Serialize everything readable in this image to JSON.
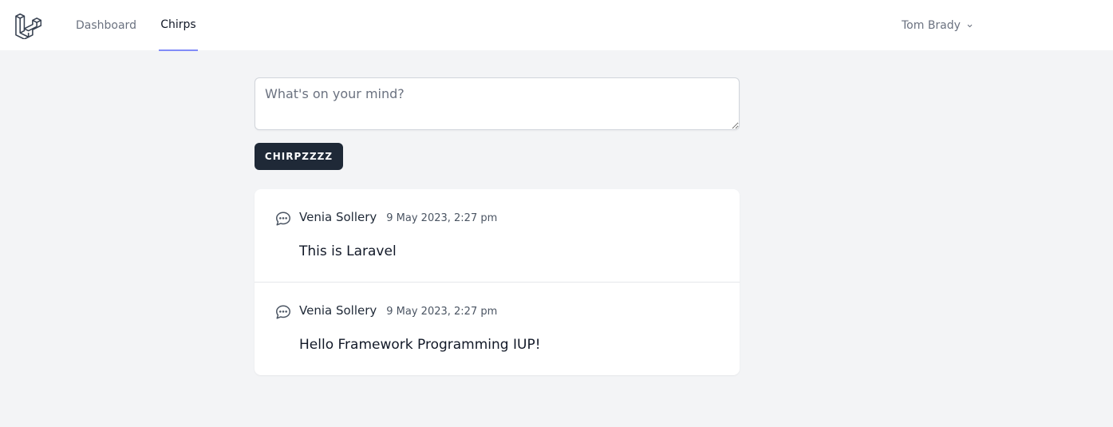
{
  "nav": {
    "logo_icon": "laravel-logo",
    "links": [
      {
        "label": "Dashboard",
        "active": false
      },
      {
        "label": "Chirps",
        "active": true
      }
    ],
    "user_name": "Tom Brady",
    "user_menu_icon": "chevron-down-icon"
  },
  "composer": {
    "placeholder": "What's on your mind?",
    "value": "",
    "submit_label": "CHIRPZZZZ"
  },
  "chirps": [
    {
      "icon": "chat-bubble-icon",
      "author": "Venia Sollery",
      "date": "9 May 2023, 2:27 pm",
      "message": "This is Laravel"
    },
    {
      "icon": "chat-bubble-icon",
      "author": "Venia Sollery",
      "date": "9 May 2023, 2:27 pm",
      "message": "Hello Framework Programming IUP!"
    }
  ],
  "colors": {
    "page_bg": "#f3f4f6",
    "button_bg": "#1f2937",
    "active_tab_underline": "#818cf8"
  }
}
